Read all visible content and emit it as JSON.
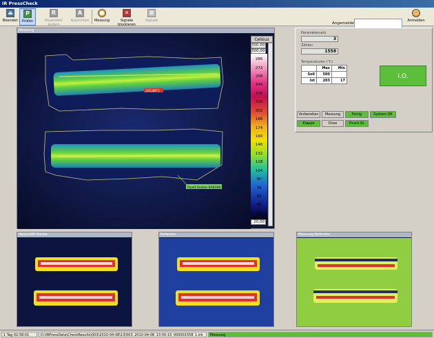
{
  "app": {
    "title": "IR PressCheck"
  },
  "toolbar": {
    "beenden": "Beenden",
    "pruefen": "Prüfen",
    "parameter_aendern": "Parameter ändern",
    "ausrichten": "Ausrichten",
    "messung": "Messung",
    "signale_blockieren": "Signale blockieren",
    "signale": "Signale",
    "angemeldet_label": "Angemeldet:",
    "angemeldet_value": "",
    "anmelden": "Anmelden"
  },
  "main_view": {
    "title": "Messung",
    "hotspot_label": "203,89°C",
    "annotation": "Punkt Rocker KA8398",
    "scale": {
      "unit": "Celsius",
      "max_value": "300,00",
      "min_value": "20,00",
      "ticks": [
        "286",
        "272",
        "258",
        "244",
        "230",
        "216",
        "202",
        "188",
        "174",
        "160",
        "146",
        "132",
        "118",
        "104",
        "90",
        "76",
        "62",
        "48",
        "34"
      ]
    }
  },
  "parameters": {
    "parametersatz_label": "Parametersatz",
    "parametersatz_value": "3",
    "zaehlen_label": "Zählen",
    "zaehlen_value": "1558",
    "temperaturen_label": "Temperaturen (°C)",
    "table": {
      "headers": [
        "",
        "Max",
        "Min"
      ],
      "rows": [
        {
          "label": "Soll",
          "max": "500",
          "min": ""
        },
        {
          "label": "Ist",
          "max": "203",
          "min": "17"
        }
      ]
    },
    "result": "i.O.",
    "result_color": "#5cbf3c"
  },
  "status_buttons": {
    "vorbereiten": "Vorbereiten",
    "messung": "Messung",
    "fertig": "Fertig",
    "system_ok": "System OK",
    "klappe": "Klappe",
    "duese": "Düse",
    "druck_kl": "Druck KL",
    "active_color": "#5cbf3c"
  },
  "thumbnails": [
    {
      "title": "VarioCAM Stereo"
    },
    {
      "title": "Referenz"
    },
    {
      "title": "Messung-Referenz"
    }
  ],
  "statusbar": {
    "uptime": "1 Tag 02:58:01",
    "path": "D:\\IRPressData\\CheckResults\\003\\2010-04-08\\13\\003_2010-04-08_13-50-15_000001558_1.irb",
    "state": "Messung"
  }
}
